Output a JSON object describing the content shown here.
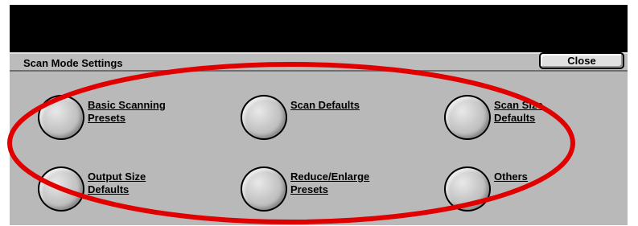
{
  "dialog": {
    "title": "Scan Mode Settings",
    "close_label": "Close"
  },
  "options": [
    {
      "line1": "Basic Scanning",
      "line2": "Presets"
    },
    {
      "line1": "Scan Defaults",
      "line2": ""
    },
    {
      "line1": "Scan Size",
      "line2": "Defaults"
    },
    {
      "line1": "Output Size",
      "line2": "Defaults"
    },
    {
      "line1": "Reduce/Enlarge",
      "line2": "Presets"
    },
    {
      "line1": "Others",
      "line2": ""
    }
  ],
  "colors": {
    "panel": "#b9b9b9",
    "header_bar": "#bcbcbc",
    "screen_border": "#000000",
    "annotation_ellipse": "#e00000"
  },
  "icons": {
    "option_button": "round-button-icon"
  }
}
